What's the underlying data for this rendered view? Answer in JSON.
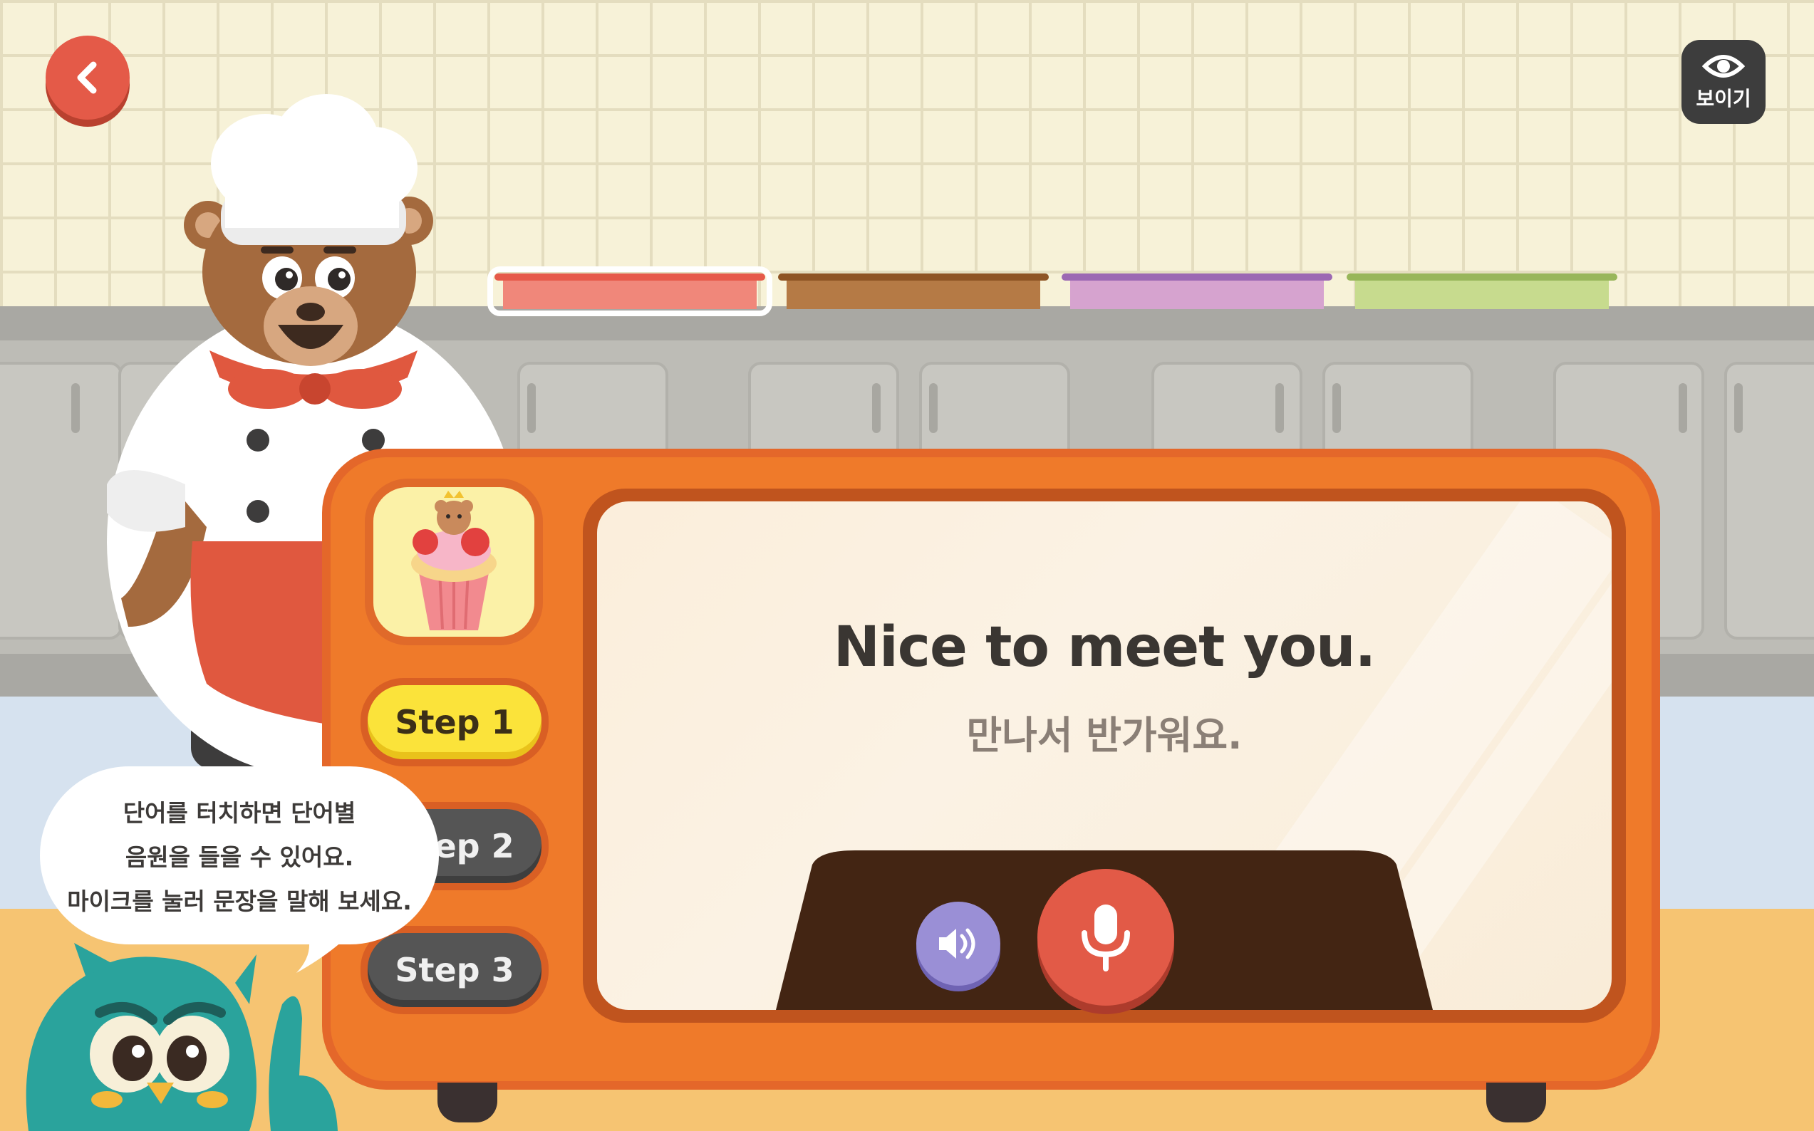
{
  "toolbar": {
    "back_icon": "chevron-left-icon",
    "show_label": "보이기",
    "show_icon": "eye-icon"
  },
  "progress": {
    "segments": [
      {
        "color": "#f0877a",
        "rim": "#e65a4a",
        "active": true
      },
      {
        "color": "#b57a45",
        "rim": "#8e5424",
        "active": false
      },
      {
        "color": "#d6a3cf",
        "rim": "#9c68b3",
        "active": false
      },
      {
        "color": "#c7db8e",
        "rim": "#98b65a",
        "active": false
      }
    ]
  },
  "steps": [
    {
      "label": "Step 1",
      "state": "active"
    },
    {
      "label": "Step 2",
      "state": "inactive"
    },
    {
      "label": "Step 3",
      "state": "inactive"
    }
  ],
  "thumbnail": {
    "icon": "strawberry-cupcake-icon"
  },
  "sentence": {
    "english": "Nice to meet you.",
    "korean": "만나서 반가워요."
  },
  "controls": {
    "speaker_icon": "speaker-icon",
    "mic_icon": "microphone-icon"
  },
  "tip": {
    "line1": "단어를 터치하면 단어별",
    "line2": "음원을 들을 수 있어요.",
    "line3": "마이크를 눌러 문장을 말해 보세요."
  },
  "colors": {
    "machine": "#ef7a2a",
    "step_active": "#fbe33a",
    "step_inactive": "#555555",
    "mic": "#e25a47",
    "speaker": "#9a8fd6"
  }
}
